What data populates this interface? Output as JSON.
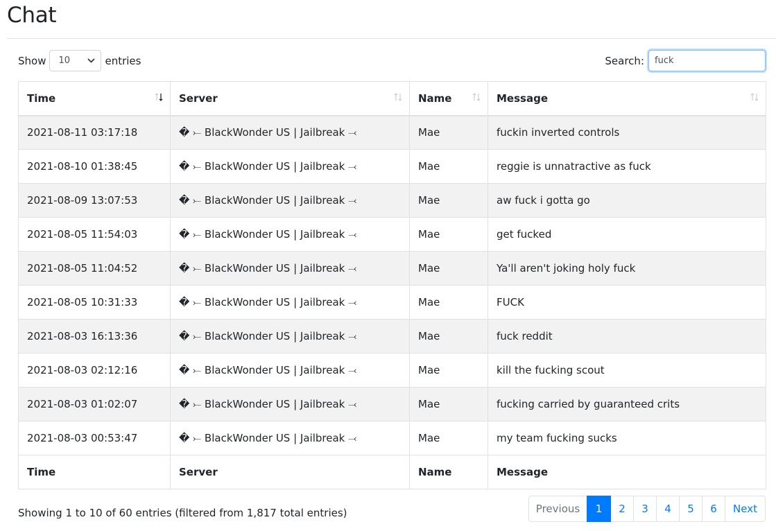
{
  "page": {
    "title": "Chat"
  },
  "length_control": {
    "prefix": "Show",
    "selected": "10",
    "suffix": "entries"
  },
  "search": {
    "label": "Search:",
    "value": "fuck"
  },
  "table": {
    "columns": [
      "Time",
      "Server",
      "Name",
      "Message"
    ],
    "rows": [
      {
        "time": "2021-08-11 03:17:18",
        "server": "� ⤚ BlackWonder US | Jailbreak ⤙",
        "name": "Mae",
        "message": "fuckin inverted controls"
      },
      {
        "time": "2021-08-10 01:38:45",
        "server": "� ⤚ BlackWonder US | Jailbreak ⤙",
        "name": "Mae",
        "message": "reggie is unnatractive as fuck"
      },
      {
        "time": "2021-08-09 13:07:53",
        "server": "� ⤚ BlackWonder US | Jailbreak ⤙",
        "name": "Mae",
        "message": "aw fuck i gotta go"
      },
      {
        "time": "2021-08-05 11:54:03",
        "server": "� ⤚ BlackWonder US | Jailbreak ⤙",
        "name": "Mae",
        "message": "get fucked"
      },
      {
        "time": "2021-08-05 11:04:52",
        "server": "� ⤚ BlackWonder US | Jailbreak ⤙",
        "name": "Mae",
        "message": "Ya'll aren't joking holy fuck"
      },
      {
        "time": "2021-08-05 10:31:33",
        "server": "� ⤚ BlackWonder US | Jailbreak ⤙",
        "name": "Mae",
        "message": "FUCK"
      },
      {
        "time": "2021-08-03 16:13:36",
        "server": "� ⤚ BlackWonder US | Jailbreak ⤙",
        "name": "Mae",
        "message": "fuck reddit"
      },
      {
        "time": "2021-08-03 02:12:16",
        "server": "� ⤚ BlackWonder US | Jailbreak ⤙",
        "name": "Mae",
        "message": "kill the fucking scout"
      },
      {
        "time": "2021-08-03 01:02:07",
        "server": "� ⤚ BlackWonder US | Jailbreak ⤙",
        "name": "Mae",
        "message": "fucking carried by guaranteed crits"
      },
      {
        "time": "2021-08-03 00:53:47",
        "server": "� ⤚ BlackWonder US | Jailbreak ⤙",
        "name": "Mae",
        "message": "my team fucking sucks"
      }
    ]
  },
  "info": "Showing 1 to 10 of 60 entries (filtered from 1,817 total entries)",
  "pagination": {
    "previous": "Previous",
    "pages": [
      "1",
      "2",
      "3",
      "4",
      "5",
      "6"
    ],
    "active": "1",
    "next": "Next"
  },
  "colors": {
    "accent": "#007bff",
    "stripe": "#f2f2f2",
    "border": "#dee2e6"
  },
  "icons": {
    "sort": "sort-arrows-icon",
    "select_caret": "chevron-down-icon"
  }
}
